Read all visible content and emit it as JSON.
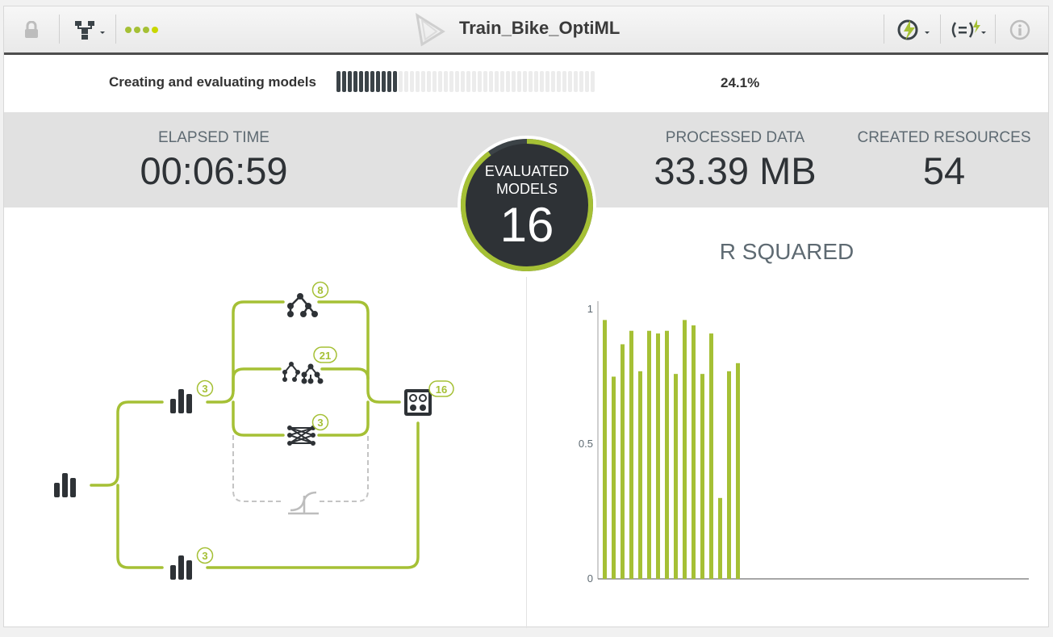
{
  "toolbar": {
    "title": "Train_Bike_OptiML",
    "icons": [
      "lock-icon",
      "tree-view-icon",
      "dots-status-icon",
      "optiml-logo-icon",
      "evaluate-lightning-icon",
      "whizzml-script-icon",
      "info-icon"
    ]
  },
  "progress": {
    "label": "Creating and evaluating models",
    "percent_text": "24.1%",
    "fraction": 0.241,
    "total_segments": 46
  },
  "stats": {
    "elapsed_label": "ELAPSED TIME",
    "elapsed_value": "00:06:59",
    "evaluated_label_1": "EVALUATED",
    "evaluated_label_2": "MODELS",
    "evaluated_value": "16",
    "evaluated_fraction": 0.9,
    "processed_label": "PROCESSED DATA",
    "processed_value": "33.39 MB",
    "created_label": "CREATED RESOURCES",
    "created_value": "54"
  },
  "flow": {
    "decision_tree_count": "8",
    "ensemble_count": "21",
    "deepnet_count": "3",
    "logistic_count": "",
    "train_dataset_count": "3",
    "test_dataset_count": "3",
    "evaluations_count": "16"
  },
  "colors": {
    "accent": "#a5c035",
    "dark": "#2e3236",
    "dashed": "#c4c4c4"
  },
  "chart_data": {
    "type": "bar",
    "title": "R SQUARED",
    "ylim": [
      0,
      1
    ],
    "y_ticks": [
      "0",
      "0.5",
      "1"
    ],
    "values": [
      0.96,
      0.75,
      0.87,
      0.92,
      0.77,
      0.92,
      0.91,
      0.92,
      0.76,
      0.96,
      0.94,
      0.76,
      0.91,
      0.3,
      0.77,
      0.8
    ],
    "grid": false
  }
}
